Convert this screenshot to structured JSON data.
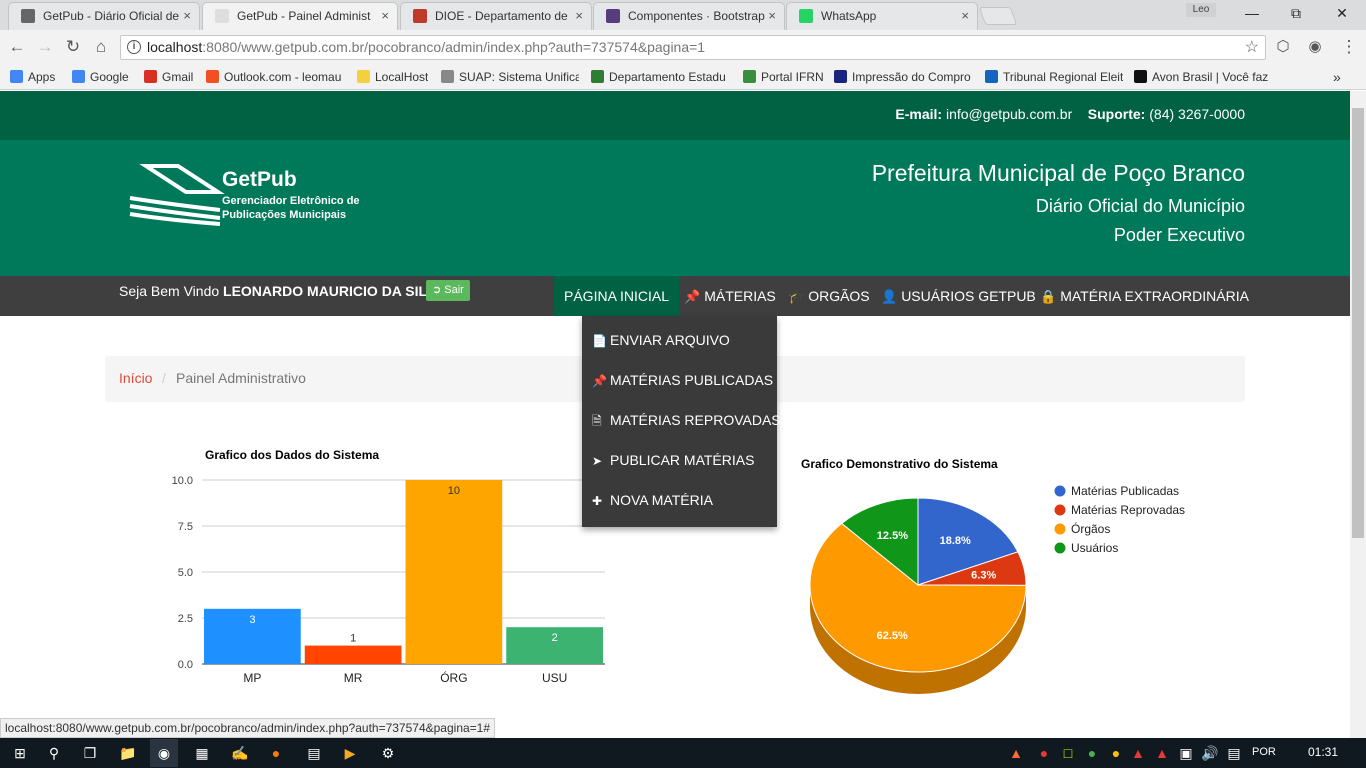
{
  "browser": {
    "tabs": [
      {
        "title": "GetPub - Diário Oficial de",
        "color": "#666"
      },
      {
        "title": "GetPub - Painel Administ",
        "color": "#ddd"
      },
      {
        "title": "DIOE - Departamento de",
        "color": "#c0392b"
      },
      {
        "title": "Componentes · Bootstrap",
        "color": "#563d7c"
      },
      {
        "title": "WhatsApp",
        "color": "#25d366"
      }
    ],
    "tab_close": "×",
    "profile": "Leo",
    "url_host": "localhost",
    "url_rest": ":8080/www.getpub.com.br/pocobranco/admin/index.php?auth=737574&pagina=1",
    "bookmarks": [
      {
        "label": "Apps",
        "color": "#4285f4"
      },
      {
        "label": "Google",
        "color": "#4285f4"
      },
      {
        "label": "Gmail",
        "color": "#d93025"
      },
      {
        "label": "Outlook.com - leomau",
        "color": "#f25022"
      },
      {
        "label": "LocalHost",
        "color": "#f4d03f"
      },
      {
        "label": "SUAP: Sistema Unifica",
        "color": "#888"
      },
      {
        "label": "Departamento Estadu",
        "color": "#2e7d32"
      },
      {
        "label": "Portal IFRN",
        "color": "#388e3c"
      },
      {
        "label": "Impressão do Compro",
        "color": "#1a237e"
      },
      {
        "label": "Tribunal Regional Eleit",
        "color": "#1565c0"
      },
      {
        "label": "Avon Brasil | Você faz",
        "color": "#111"
      }
    ],
    "more_bookmarks": "»",
    "status_url": "localhost:8080/www.getpub.com.br/pocobranco/admin/index.php?auth=737574&pagina=1#"
  },
  "site": {
    "email_label": "E-mail:",
    "email": "info@getpub.com.br",
    "support_label": "Suporte:",
    "support": "(84) 3267-0000",
    "logo_title": "GetPub",
    "logo_sub_1": "Gerenciador Eletrônico de",
    "logo_sub_2": "Publicações Municipais",
    "pref_title": "Prefeitura Municipal de Poço Branco",
    "pref_sub1": "Diário Oficial do Município",
    "pref_sub2": "Poder Executivo",
    "welcome_prefix": "Seja Bem Vindo",
    "welcome_user": "LEONARDO MAURICIO DA SILVA",
    "logout": "Sair",
    "nav": [
      "PÁGINA INICIAL",
      "MÁTERIAS",
      "ORGÃOS",
      "USUÁRIOS GETPUB",
      "MATÉRIA EXTRAORDINÁRIA"
    ],
    "dropdown": [
      "ENVIAR ARQUIVO",
      "MATÉRIAS PUBLICADAS",
      "MATÉRIAS REPROVADAS",
      "PUBLICAR MATÉRIAS",
      "NOVA MATÉRIA"
    ],
    "breadcrumb_home": "Início",
    "breadcrumb_sep": "/",
    "breadcrumb_current": "Painel Administrativo"
  },
  "chart_data": [
    {
      "type": "bar",
      "title": "Grafico dos Dados do Sistema",
      "categories": [
        "MP",
        "MR",
        "ÓRG",
        "USU"
      ],
      "values": [
        3,
        1,
        10,
        2
      ],
      "colors": [
        "#1e90ff",
        "#ff4500",
        "#ffa500",
        "#3cb371"
      ],
      "yticks": [
        "0.0",
        "2.5",
        "5.0",
        "7.5",
        "10.0"
      ],
      "ylim": [
        0,
        10
      ],
      "grid": true
    },
    {
      "type": "pie",
      "title": "Grafico Demonstrativo do Sistema",
      "labels": [
        "Matérias Publicadas",
        "Matérias Reprovadas",
        "Órgãos",
        "Usuários"
      ],
      "values": [
        18.8,
        6.3,
        62.5,
        12.5
      ],
      "value_labels": [
        "18.8%",
        "6.3%",
        "62.5%",
        "12.5%"
      ],
      "colors": [
        "#3366cc",
        "#dc3912",
        "#ff9900",
        "#109618"
      ],
      "legend": "right"
    }
  ],
  "taskbar": {
    "lang": "POR",
    "time": "01:31"
  }
}
